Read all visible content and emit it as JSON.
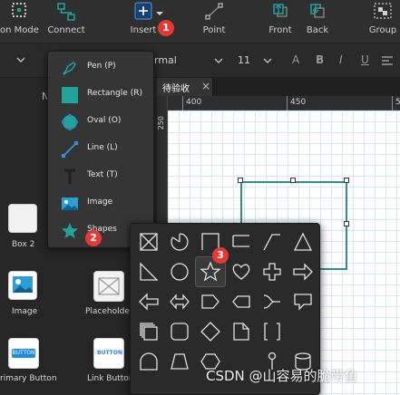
{
  "toolbar": {
    "tools": [
      {
        "name": "connection-mode",
        "label": "on Mode",
        "icon": "connection-mode-icon"
      },
      {
        "name": "connect",
        "label": "Connect",
        "icon": "connect-icon"
      },
      {
        "name": "insert",
        "label": "Insert",
        "icon": "plus-icon"
      },
      {
        "name": "point",
        "label": "Point",
        "icon": "point-icon"
      },
      {
        "name": "front",
        "label": "Front",
        "icon": "bring-front-icon"
      },
      {
        "name": "back",
        "label": "Back",
        "icon": "send-back-icon"
      },
      {
        "name": "group",
        "label": "Group",
        "icon": "group-icon"
      }
    ],
    "insert_badge": "1"
  },
  "formatbar": {
    "font_family": "rmal",
    "font_size": "11"
  },
  "tabs": {
    "active": "待验收",
    "close_glyph": "×",
    "left_cut_label": "N"
  },
  "ruler": {
    "h_ticks": [
      "400",
      "450",
      "500"
    ],
    "v_ticks": [
      "250"
    ]
  },
  "insert_menu": {
    "items": [
      {
        "label": "Pen (P)",
        "icon": "pen-icon"
      },
      {
        "label": "Rectangle (R)",
        "icon": "rectangle-icon"
      },
      {
        "label": "Oval (O)",
        "icon": "oval-icon"
      },
      {
        "label": "Line (L)",
        "icon": "line-icon"
      },
      {
        "label": "Text (T)",
        "icon": "text-icon"
      },
      {
        "label": "Image",
        "icon": "image-icon"
      },
      {
        "label": "Shapes",
        "icon": "star-icon"
      }
    ],
    "shapes_badge": "2"
  },
  "components": [
    {
      "label": "Box 2"
    },
    {
      "label": "Image"
    },
    {
      "label": "Placeholder"
    },
    {
      "label": "rimary Button"
    },
    {
      "label": "Link Button"
    }
  ],
  "button_widget_text": "BUTTON",
  "shapes_popup": {
    "badge": "3",
    "selected": "star",
    "shapes": [
      "placeholder-box",
      "arc",
      "rect-corner",
      "bracket-line",
      "step-line",
      "triangle",
      "right-triangle",
      "circle",
      "star",
      "heart",
      "cross",
      "arrow-right",
      "arrow-left",
      "arrow-double",
      "pentagon-tag",
      "tag-left",
      "branch",
      "callout",
      "stack",
      "rounded-rect",
      "diamond",
      "note",
      "bracket-box",
      "empty",
      "dome",
      "trapezoid",
      "hexagon",
      "pin",
      "cylinder",
      "empty"
    ]
  },
  "watermark": "CSDN @山容易的脆带鱼",
  "colors": {
    "accent_teal": "#21a39b",
    "selection_outline": "#2e8f8f",
    "badge_red": "#e53935",
    "toolbar_bg": "#2f2f2f"
  }
}
